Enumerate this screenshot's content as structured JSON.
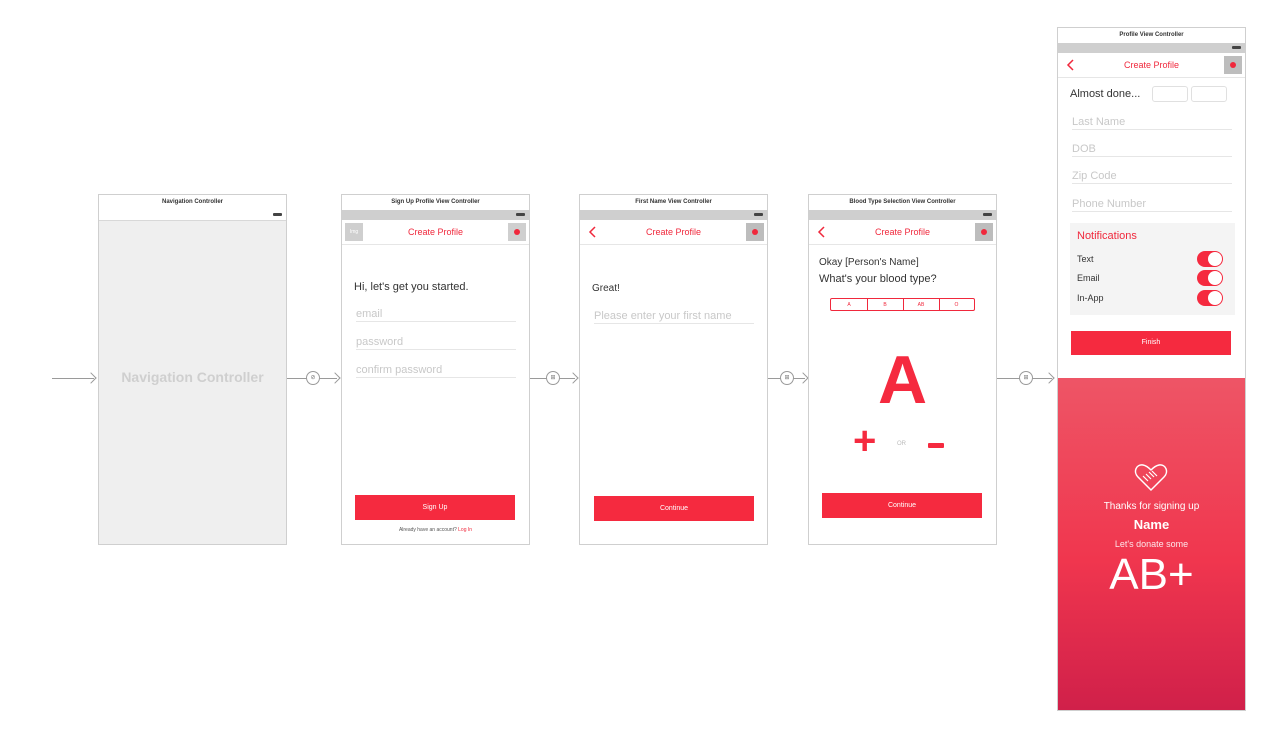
{
  "nav_controller": {
    "title": "Navigation Controller",
    "placeholder": "Navigation Controller"
  },
  "signup": {
    "title": "Sign Up Profile View Controller",
    "nav_title": "Create Profile",
    "img_left": "Img",
    "img_right": "Img",
    "greeting": "Hi, let's get you started.",
    "email_placeholder": "email",
    "password_placeholder": "password",
    "confirm_placeholder": "confirm password",
    "button": "Sign Up",
    "footer_text": "Already have an account?",
    "footer_link": "Log In"
  },
  "firstname": {
    "title": "First Name View Controller",
    "nav_title": "Create Profile",
    "img_right": "Img",
    "greeting": "Great!",
    "name_placeholder": "Please enter your first name",
    "button": "Continue"
  },
  "bloodtype": {
    "title": "Blood Type Selection View Controller",
    "nav_title": "Create Profile",
    "img_right": "Img",
    "line1": "Okay [Person's Name]",
    "line2": "What's your blood type?",
    "segments": [
      "A",
      "B",
      "AB",
      "O"
    ],
    "big_letter": "A",
    "plus": "+",
    "or": "OR",
    "minus": "-",
    "button": "Continue"
  },
  "profile": {
    "title": "Profile View Controller",
    "nav_title": "Create Profile",
    "img_right": "Img",
    "almost_done": "Almost done...",
    "fields": [
      "Last Name",
      "DOB",
      "Zip Code",
      "Phone Number"
    ],
    "notifications_title": "Notifications",
    "toggles": [
      {
        "label": "Text",
        "on": true
      },
      {
        "label": "Email",
        "on": true
      },
      {
        "label": "In-App",
        "on": true
      }
    ],
    "button": "Finish",
    "thanks": "Thanks for signing up",
    "name": "Name",
    "donate": "Let's donate some",
    "blood_type": "AB+"
  },
  "colors": {
    "accent": "#f52a3f",
    "gradient_top": "#ee5566",
    "gradient_bottom": "#d0204a"
  }
}
